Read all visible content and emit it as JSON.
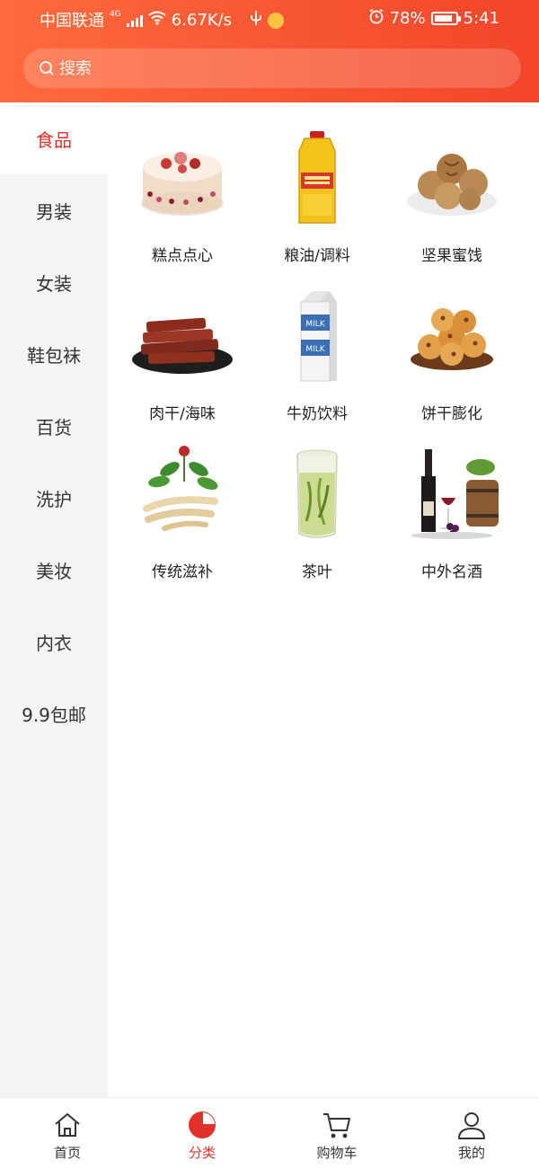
{
  "status_bar": {
    "carrier": "中国联通",
    "network_tag": "4G",
    "speed": "6.67K/s",
    "battery": "78%",
    "time": "5:41"
  },
  "search": {
    "placeholder": "搜索"
  },
  "sidebar": {
    "items": [
      {
        "label": "食品",
        "active": true
      },
      {
        "label": "男装"
      },
      {
        "label": "女装"
      },
      {
        "label": "鞋包袜"
      },
      {
        "label": "百货"
      },
      {
        "label": "洗护"
      },
      {
        "label": "美妆"
      },
      {
        "label": "内衣"
      },
      {
        "label": "9.9包邮"
      }
    ]
  },
  "categories": [
    {
      "label": "糕点点心",
      "icon": "cake-icon"
    },
    {
      "label": "粮油/调料",
      "icon": "oil-bottle-icon"
    },
    {
      "label": "坚果蜜饯",
      "icon": "walnut-icon"
    },
    {
      "label": "肉干/海味",
      "icon": "jerky-icon"
    },
    {
      "label": "牛奶饮料",
      "icon": "milk-carton-icon",
      "carton_text": "MILK"
    },
    {
      "label": "饼干膨化",
      "icon": "cookies-icon"
    },
    {
      "label": "传统滋补",
      "icon": "ginseng-icon"
    },
    {
      "label": "茶叶",
      "icon": "tea-glass-icon"
    },
    {
      "label": "中外名酒",
      "icon": "wine-icon"
    }
  ],
  "bottom_nav": [
    {
      "label": "首页",
      "icon": "home-icon"
    },
    {
      "label": "分类",
      "icon": "category-icon",
      "active": true
    },
    {
      "label": "购物车",
      "icon": "cart-icon"
    },
    {
      "label": "我的",
      "icon": "user-icon"
    }
  ],
  "colors": {
    "accent": "#e0312a",
    "header_start": "#ff6a3d",
    "header_end": "#f3452a",
    "sidebar_bg": "#f4f4f4"
  }
}
